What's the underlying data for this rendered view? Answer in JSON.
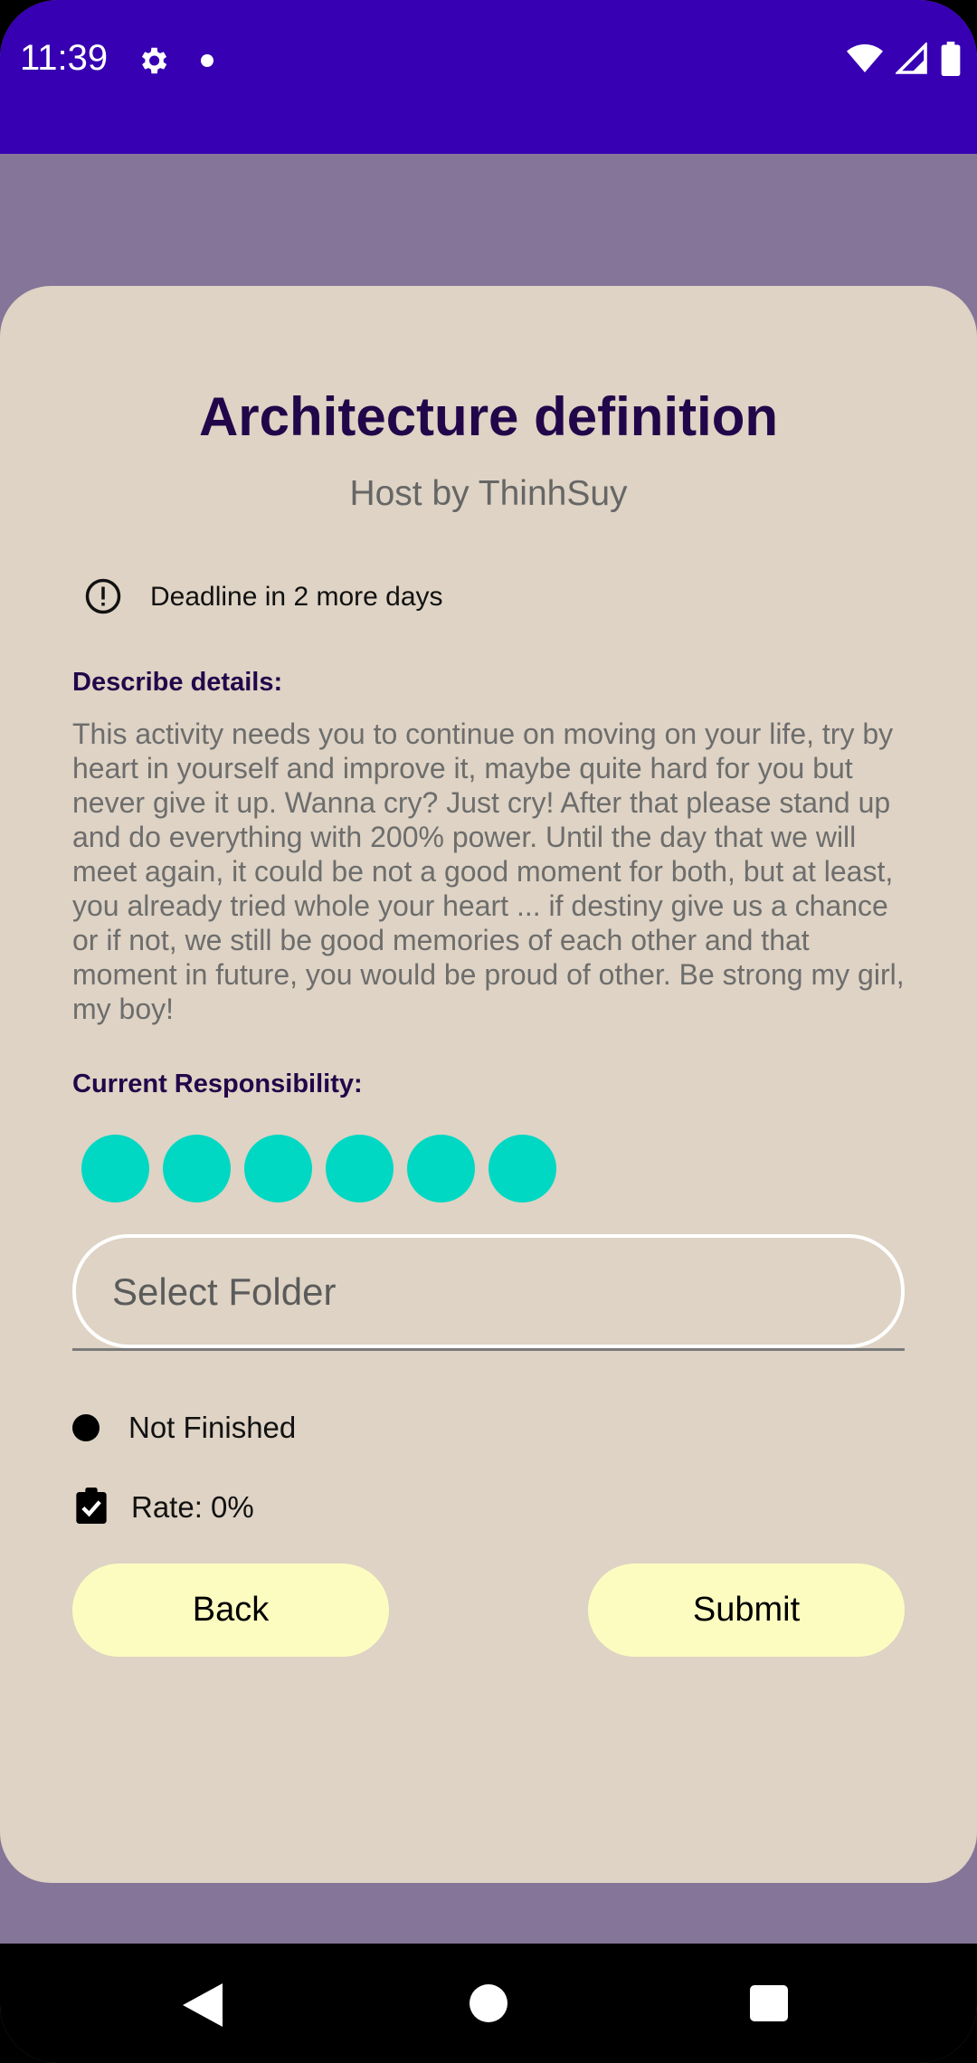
{
  "status_bar": {
    "time": "11:39",
    "icons": [
      "gear-icon",
      "notification-dot-icon",
      "wifi-icon",
      "signal-icon",
      "battery-icon"
    ]
  },
  "task": {
    "title": "Architecture definition",
    "host": "Host by ThinhSuy",
    "deadline": "Deadline in 2 more days",
    "describe_label": "Describe details:",
    "description": "This activity needs you to continue on moving on your life, try by heart in yourself and improve it, maybe quite hard for you but never give it up. Wanna cry? Just cry! After that please stand up and do everything with 200% power. Until the day that we will meet again, it could be not a good moment for both, but at least, you already tried whole your heart ... if destiny give us a chance or if not, we still be good memories of each other and that moment in future, you would be proud of other. Be strong my girl, my boy!",
    "responsibility_label": "Current Responsibility:",
    "responsibility_count": 6,
    "select_folder_placeholder": "Select Folder",
    "status": "Not Finished",
    "rate": "Rate: 0%"
  },
  "buttons": {
    "back": "Back",
    "submit": "Submit"
  },
  "colors": {
    "status_bar": "#3700b3",
    "backdrop": "#857599",
    "card": "#ded3c4",
    "title": "#22064a",
    "avatar_dot": "#00d8c4",
    "button": "#fcfcc1"
  }
}
